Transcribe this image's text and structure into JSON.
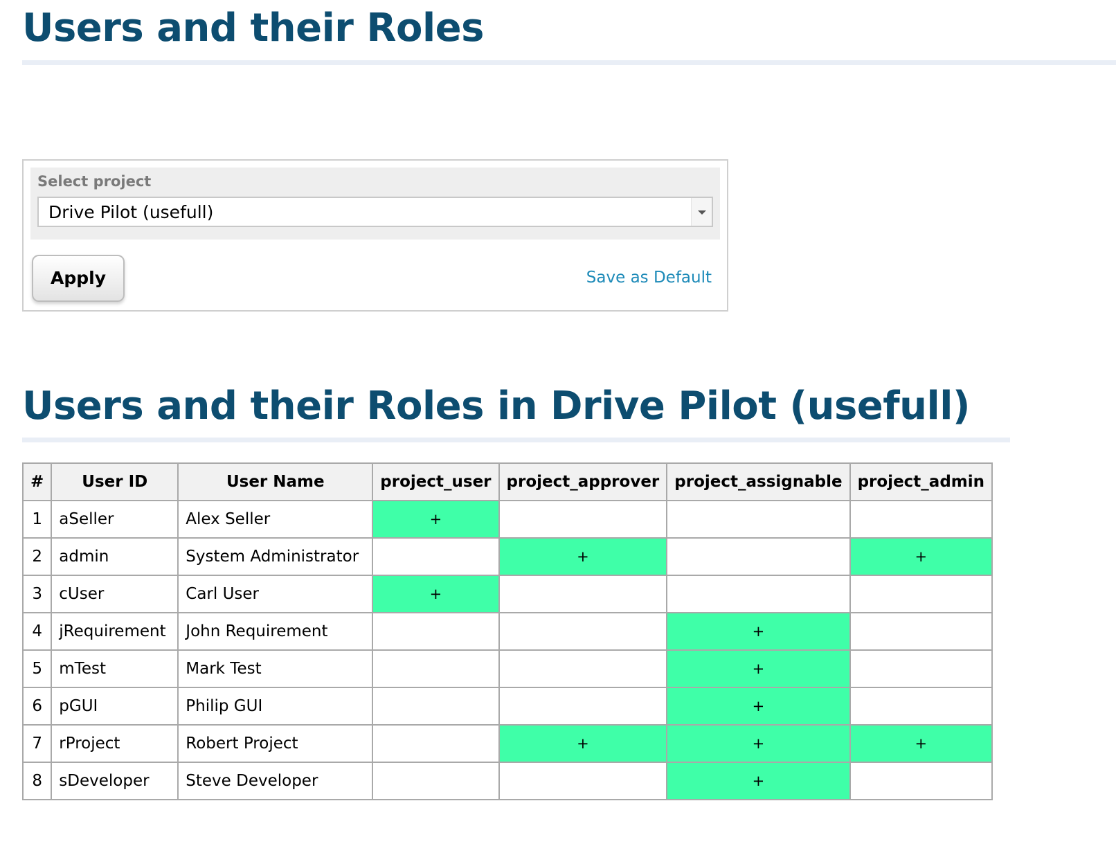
{
  "page": {
    "title": "Users and their Roles"
  },
  "filter": {
    "label": "Select project",
    "selected_project": "Drive Pilot (usefull)",
    "apply_label": "Apply",
    "save_default_label": "Save as Default"
  },
  "results": {
    "title": "Users and their Roles in Drive Pilot (usefull)"
  },
  "table": {
    "headers": [
      "#",
      "User ID",
      "User Name",
      "project_user",
      "project_approver",
      "project_assignable",
      "project_admin"
    ],
    "rows": [
      {
        "num": "1",
        "user_id": "aSeller",
        "user_name": "Alex Seller",
        "roles": [
          "+",
          "",
          "",
          ""
        ]
      },
      {
        "num": "2",
        "user_id": "admin",
        "user_name": "System Administrator",
        "roles": [
          "",
          "+",
          "",
          "+"
        ]
      },
      {
        "num": "3",
        "user_id": "cUser",
        "user_name": "Carl User",
        "roles": [
          "+",
          "",
          "",
          ""
        ]
      },
      {
        "num": "4",
        "user_id": "jRequirement",
        "user_name": "John Requirement",
        "roles": [
          "",
          "",
          "+",
          ""
        ]
      },
      {
        "num": "5",
        "user_id": "mTest",
        "user_name": "Mark Test",
        "roles": [
          "",
          "",
          "+",
          ""
        ]
      },
      {
        "num": "6",
        "user_id": "pGUI",
        "user_name": "Philip GUI",
        "roles": [
          "",
          "",
          "+",
          ""
        ]
      },
      {
        "num": "7",
        "user_id": "rProject",
        "user_name": "Robert Project",
        "roles": [
          "",
          "+",
          "+",
          "+"
        ]
      },
      {
        "num": "8",
        "user_id": "sDeveloper",
        "user_name": "Steve Developer",
        "roles": [
          "",
          "",
          "+",
          ""
        ]
      }
    ]
  },
  "colors": {
    "heading": "#0d4d70",
    "role_assigned": "#3fffa8",
    "link": "#1d8ab8"
  }
}
